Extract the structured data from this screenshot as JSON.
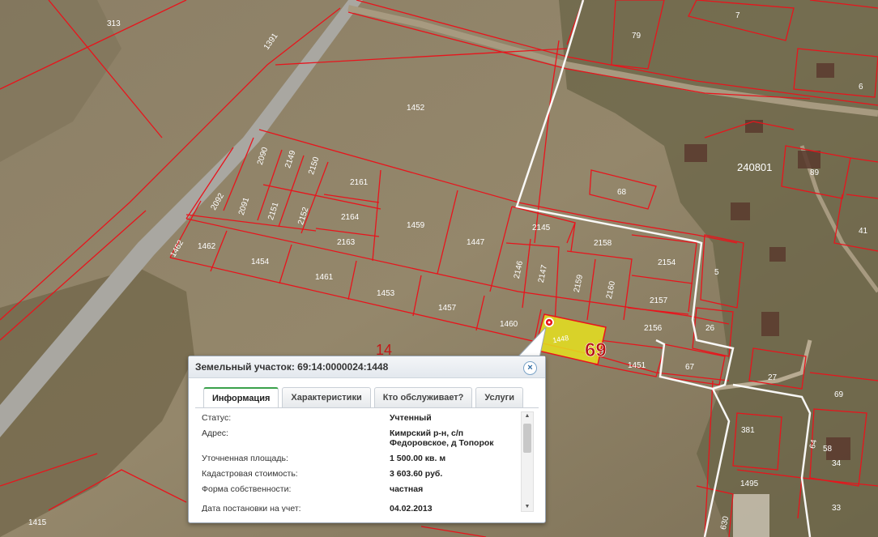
{
  "map": {
    "labels": {
      "l313": "313",
      "l1391": "1391",
      "l1452": "1452",
      "l7": "7",
      "l79": "79",
      "l6": "6",
      "l2090": "2090",
      "l2149": "2149",
      "l2150": "2150",
      "l2161": "2161",
      "l240801": "240801",
      "l89": "89",
      "l68": "68",
      "l2092": "2092",
      "l2091": "2091",
      "l2151": "2151",
      "l2152": "2152",
      "l2164": "2164",
      "l1459": "1459",
      "l1447": "1447",
      "l2145": "2145",
      "l2158": "2158",
      "l41": "41",
      "l2163": "2163",
      "l1462a": "1462",
      "l1462b": "1462",
      "l1454": "1454",
      "l2146": "2146",
      "l2147": "2147",
      "l2159": "2159",
      "l2160": "2160",
      "l2154": "2154",
      "l5": "5",
      "l1461": "1461",
      "l1453": "1453",
      "l2157": "2157",
      "l1457": "1457",
      "l1460": "1460",
      "l2156": "2156",
      "l26": "26",
      "l1448": "1448",
      "l69big": "69",
      "l14": "14",
      "l1451": "1451",
      "l67": "67",
      "l27": "27",
      "l69": "69",
      "l381": "381",
      "l64": "64",
      "l58": "58",
      "l34": "34",
      "l1495": "1495",
      "l33": "33",
      "l1415": "1415",
      "l630": "630"
    }
  },
  "popup": {
    "title": "Земельный участок: 69:14:0000024:1448",
    "close_icon": "×",
    "tabs": [
      "Информация",
      "Характеристики",
      "Кто обслуживает?",
      "Услуги"
    ],
    "rows": [
      {
        "label": "Статус:",
        "value": "Учтенный"
      },
      {
        "label": "Адрес:",
        "value": "Кимрский р-н, с/п Федоровское, д Топорок"
      },
      {
        "label": "Уточненная площадь:",
        "value": "1 500.00 кв. м"
      },
      {
        "label": "Кадастровая стоимость:",
        "value": "3 603.60 руб."
      },
      {
        "label": "Форма собственности:",
        "value": "частная"
      },
      {
        "label": "Дата постановки на учет:",
        "value": "04.02.2013"
      }
    ],
    "scroll_up_icon": "▲",
    "scroll_down_icon": "▼"
  },
  "colors": {
    "boundary": "#e8141c",
    "selected_fill": "#e6e01e",
    "highlight_outline": "#ffffff",
    "field": "#8a7c62",
    "tab_accent": "#3aa14b"
  }
}
